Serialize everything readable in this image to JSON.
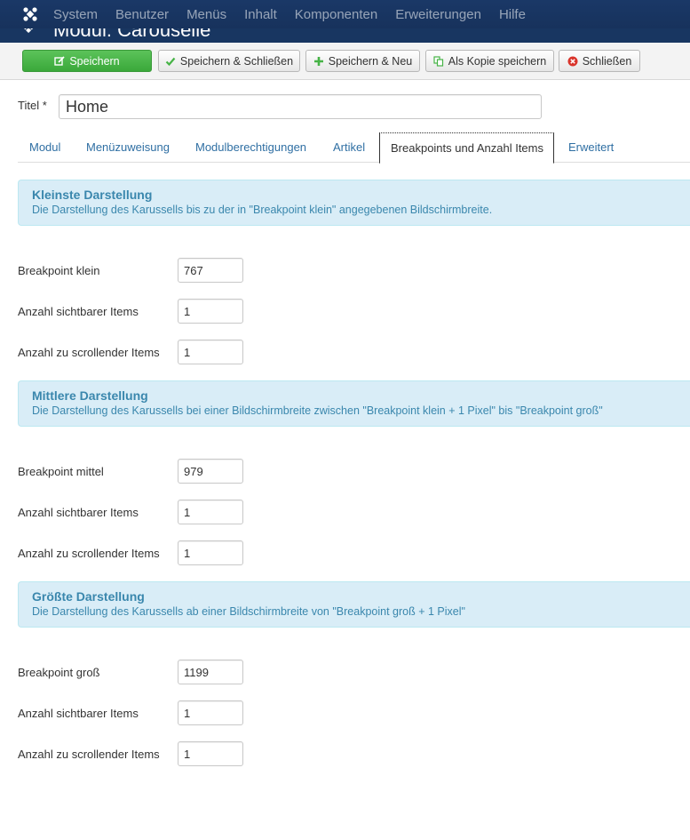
{
  "topnav": {
    "items": [
      "System",
      "Benutzer",
      "Menüs",
      "Inhalt",
      "Komponenten",
      "Erweiterungen",
      "Hilfe"
    ]
  },
  "page_header": {
    "title": "Modul: Carouselle"
  },
  "toolbar": {
    "save": "Speichern",
    "save_close": "Speichern & Schließen",
    "save_new": "Speichern & Neu",
    "save_copy": "Als Kopie speichern",
    "close": "Schließen"
  },
  "title_field": {
    "label": "Titel *",
    "value": "Home"
  },
  "tabs": [
    "Modul",
    "Menüzuweisung",
    "Modulberechtigungen",
    "Artikel",
    "Breakpoints und Anzahl Items",
    "Erweitert"
  ],
  "sections": [
    {
      "heading": "Kleinste Darstellung",
      "description": "Die Darstellung des Karussells bis zu der in \"Breakpoint klein\" angegebenen Bildschirmbreite.",
      "fields": [
        {
          "label": "Breakpoint klein",
          "value": "767"
        },
        {
          "label": "Anzahl sichtbarer Items",
          "value": "1"
        },
        {
          "label": "Anzahl zu scrollender Items",
          "value": "1"
        }
      ]
    },
    {
      "heading": "Mittlere Darstellung",
      "description": "Die Darstellung des Karussells bei einer Bildschirmbreite zwischen \"Breakpoint klein + 1 Pixel\" bis \"Breakpoint groß\"",
      "fields": [
        {
          "label": "Breakpoint mittel",
          "value": "979"
        },
        {
          "label": "Anzahl sichtbarer Items",
          "value": "1"
        },
        {
          "label": "Anzahl zu scrollender Items",
          "value": "1"
        }
      ]
    },
    {
      "heading": "Größte Darstellung",
      "description": "Die Darstellung des Karussells ab einer Bildschirmbreite von \"Breakpoint groß + 1 Pixel\"",
      "fields": [
        {
          "label": "Breakpoint groß",
          "value": "1199"
        },
        {
          "label": "Anzahl sichtbarer Items",
          "value": "1"
        },
        {
          "label": "Anzahl zu scrollender Items",
          "value": "1"
        }
      ]
    }
  ],
  "colors": {
    "nav_bg": "#17325c",
    "save_green": "#46b346",
    "info_bg": "#d9edf7",
    "info_text": "#3a87ad",
    "link_blue": "#2f6fa3",
    "close_red": "#d9342b"
  }
}
